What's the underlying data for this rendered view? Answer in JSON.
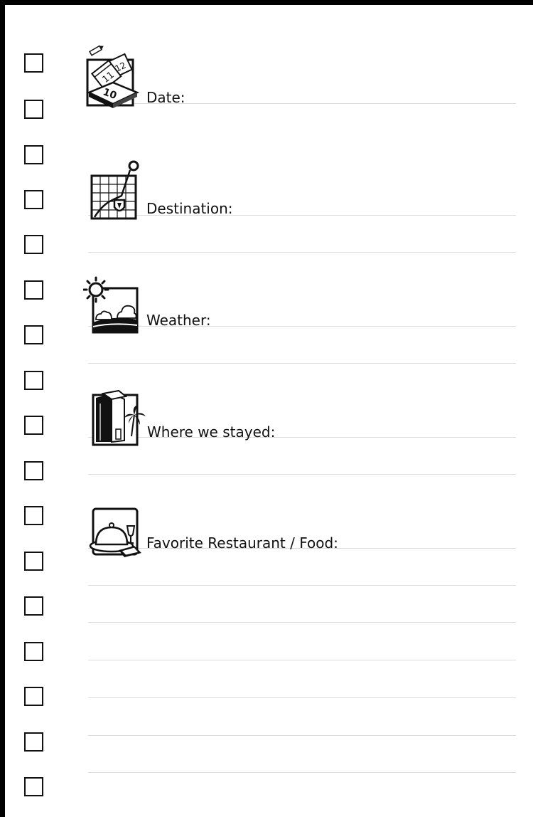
{
  "colors": {
    "border": "#000000",
    "ink": "#111111",
    "rule": "#dcdcdc",
    "paper": "#ffffff"
  },
  "checkboxes": [
    {
      "checked": false
    },
    {
      "checked": false
    },
    {
      "checked": false
    },
    {
      "checked": false
    },
    {
      "checked": false
    },
    {
      "checked": false
    },
    {
      "checked": false
    },
    {
      "checked": false
    },
    {
      "checked": false
    },
    {
      "checked": false
    },
    {
      "checked": false
    },
    {
      "checked": false
    },
    {
      "checked": false
    },
    {
      "checked": false
    },
    {
      "checked": false
    },
    {
      "checked": false
    },
    {
      "checked": false
    }
  ],
  "sections": [
    {
      "label": "Date:",
      "icon": "calendar-icon",
      "value": ""
    },
    {
      "label": "Destination:",
      "icon": "map-pin-icon",
      "value": ""
    },
    {
      "label": "Weather:",
      "icon": "sun-clouds-icon",
      "value": ""
    },
    {
      "label": "Where we stayed:",
      "icon": "hotel-palm-icon",
      "value": ""
    },
    {
      "label": "Favorite Restaurant / Food:",
      "icon": "dining-cloche-icon",
      "value": ""
    }
  ],
  "calendar": {
    "day_front": "10",
    "day_mid": "11",
    "day_back": "12"
  }
}
